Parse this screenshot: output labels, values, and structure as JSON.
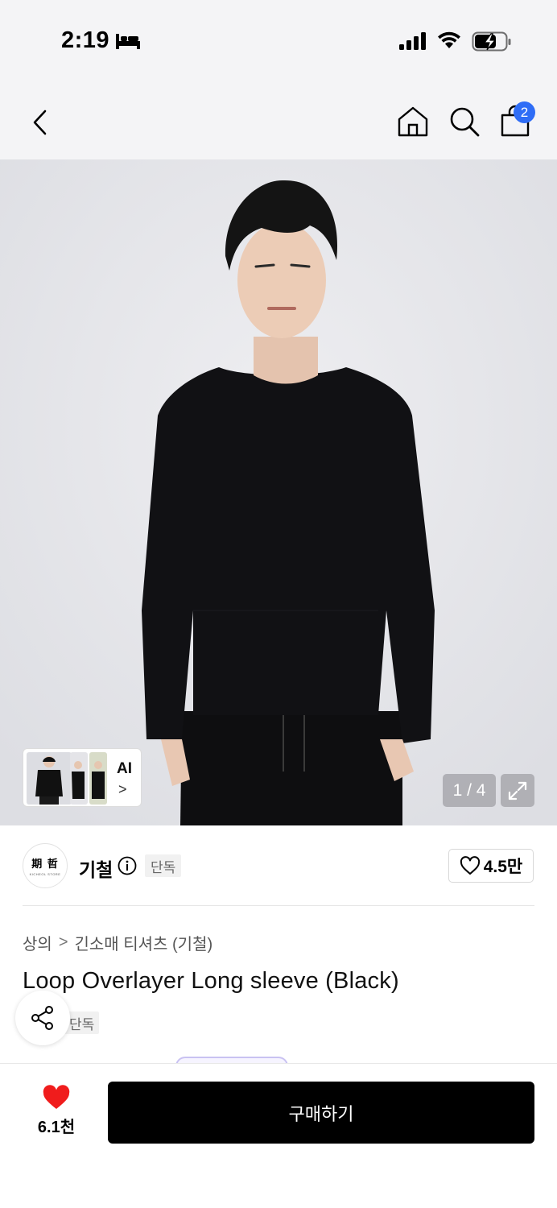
{
  "status_bar": {
    "time": "2:19"
  },
  "nav": {
    "cart_count": "2"
  },
  "gallery": {
    "ai_label": "AI",
    "ai_chevron": ">",
    "page_counter": "1 / 4"
  },
  "brand": {
    "logo_text": "期 哲",
    "logo_subtext": "KICHEOL STORE",
    "name": "기철",
    "exclusive_tag": "단독",
    "like_count": "4.5만"
  },
  "product": {
    "breadcrumb": [
      "상의",
      "긴소매 티셔츠 (기철)"
    ],
    "breadcrumb_separator": ">",
    "title": "Loop Overlayer Long sleeve (Black)",
    "exclusive_tag": "단독"
  },
  "bottom_bar": {
    "wish_count": "6.1천",
    "buy_label": "구매하기"
  },
  "colors": {
    "accent_blue": "#2f6df6",
    "heart_red": "#f01c1c",
    "buy_button": "#000000",
    "header_bg": "#f4f4f6"
  },
  "icons": [
    "bed-icon",
    "signal-icon",
    "wifi-icon",
    "battery-icon",
    "back-icon",
    "home-icon",
    "search-icon",
    "cart-icon",
    "expand-icon",
    "info-icon",
    "heart-outline-icon",
    "share-icon",
    "heart-filled-icon"
  ]
}
